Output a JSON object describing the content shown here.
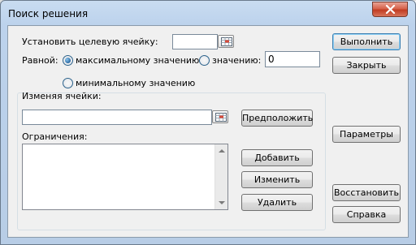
{
  "window": {
    "title": "Поиск решения"
  },
  "target": {
    "label_pre": "Установить целевую ячейку:",
    "value": ""
  },
  "equal": {
    "label": "Равной:",
    "max_label": "максимальному значению",
    "value_label": "значению:",
    "value_input": "0",
    "min_label": "минимальному значению",
    "selected": "max"
  },
  "changing": {
    "label": "Изменяя ячейки:",
    "value": "",
    "guess_button": "Предположить"
  },
  "constraints": {
    "label": "Ограничения:",
    "items": [],
    "add_button": "Добавить",
    "change_button": "Изменить",
    "delete_button": "Удалить"
  },
  "side_buttons": {
    "run": "Выполнить",
    "close": "Закрыть",
    "options": "Параметры",
    "reset": "Восстановить",
    "help": "Справка"
  },
  "colors": {
    "titlebar": "#bcd2ec",
    "close_button": "#c13c22",
    "dialog_bg": "#f0f0f0",
    "default_button_border": "#3c7fb1"
  },
  "icons": {
    "close": "close-x-icon",
    "ref": "range-select-icon",
    "scroll_up": "scroll-up-arrow-icon",
    "scroll_down": "scroll-down-arrow-icon"
  }
}
